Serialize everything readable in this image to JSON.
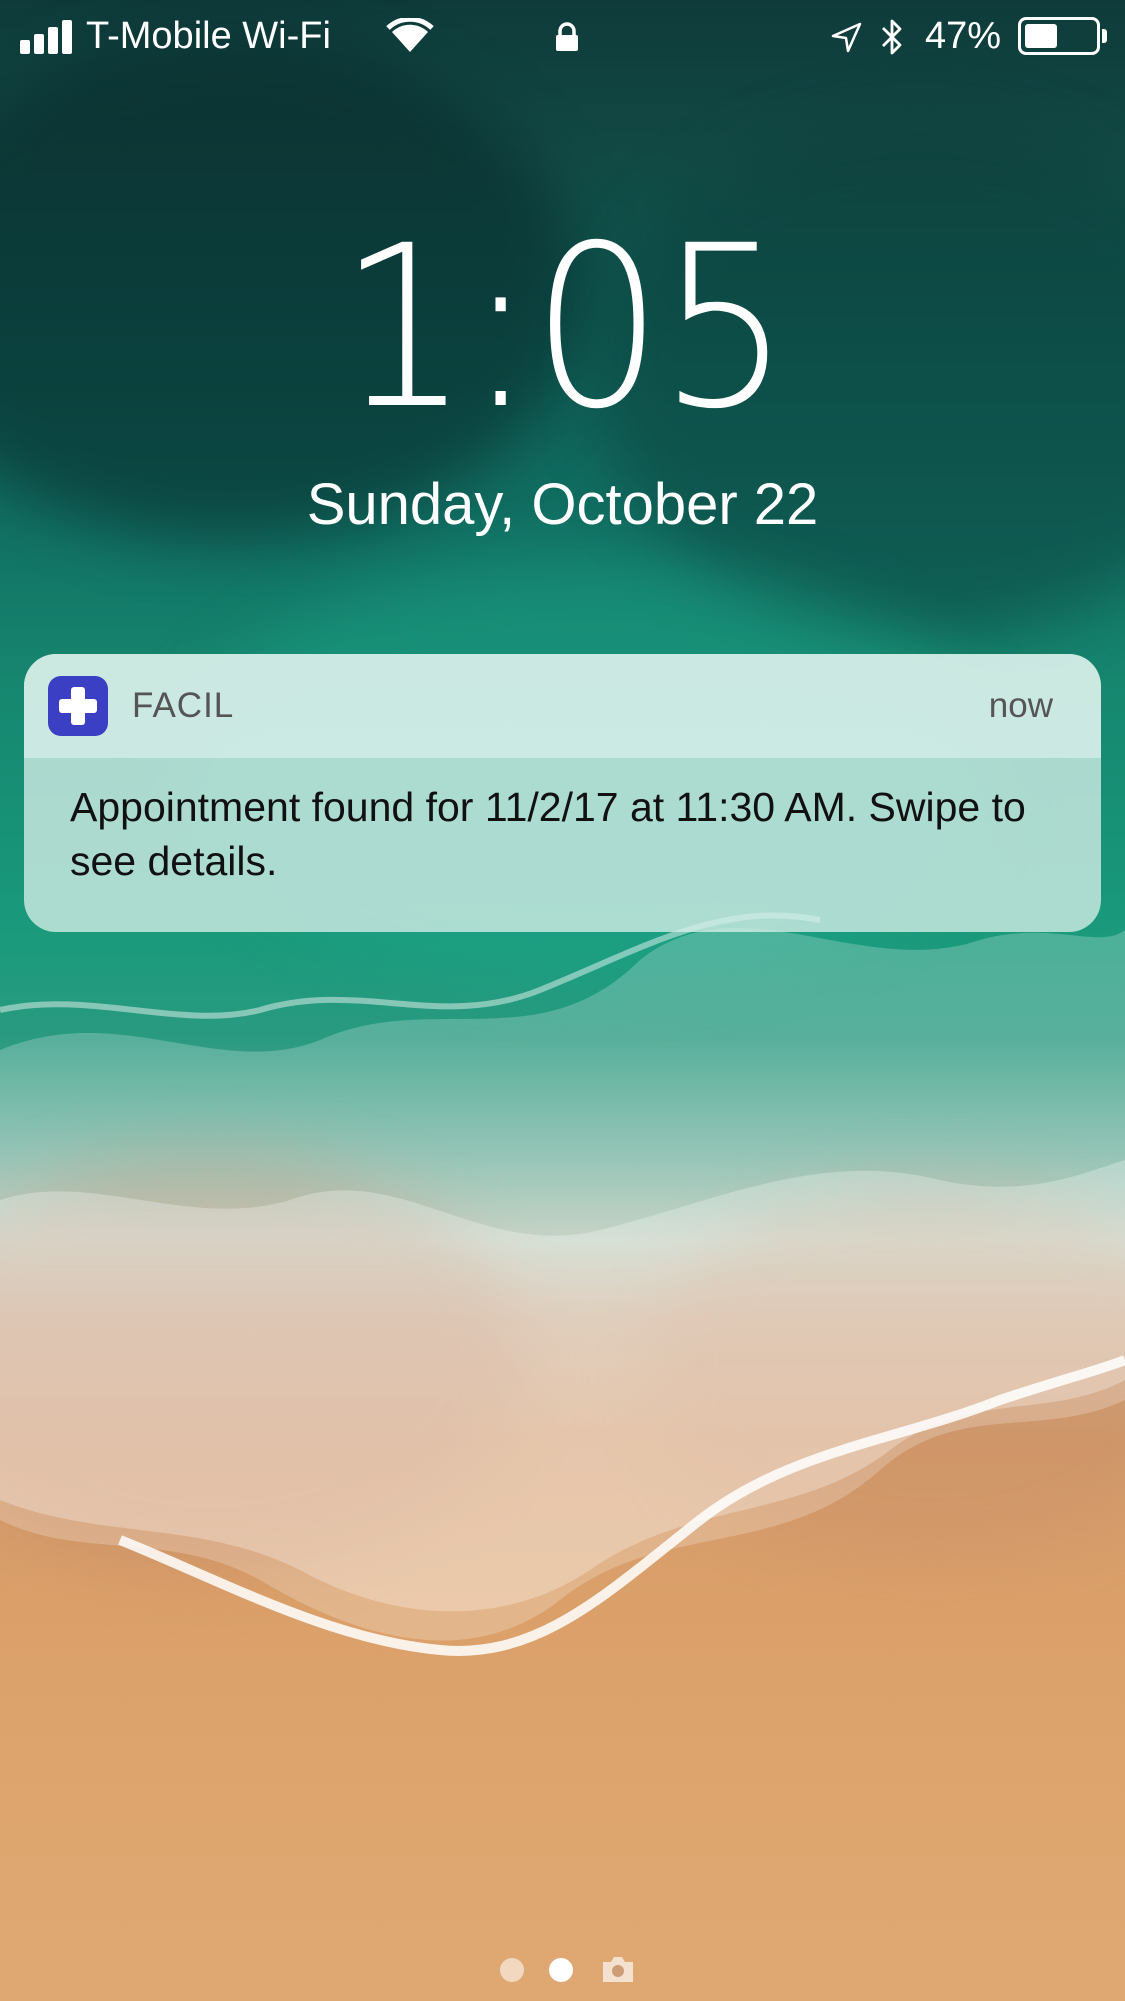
{
  "status_bar": {
    "carrier": "T-Mobile Wi-Fi",
    "battery_percent_text": "47%",
    "battery_level": 0.47,
    "signal_bars": 4,
    "icons": [
      "signal-icon",
      "wifi-icon",
      "lock-icon",
      "location-arrow-icon",
      "bluetooth-icon",
      "battery-icon"
    ]
  },
  "lock_screen": {
    "time": "1:05",
    "date": "Sunday, October 22"
  },
  "notification": {
    "app_name": "FACIL",
    "time": "now",
    "message": "Appointment found for 11/2/17 at 11:30 AM. Swipe to see details.",
    "app_icon": "medical-cross-icon",
    "app_icon_color": "#3b3fc4"
  },
  "page_indicator": {
    "pages": 2,
    "active_page": 2,
    "trailing_icon": "camera-icon"
  }
}
